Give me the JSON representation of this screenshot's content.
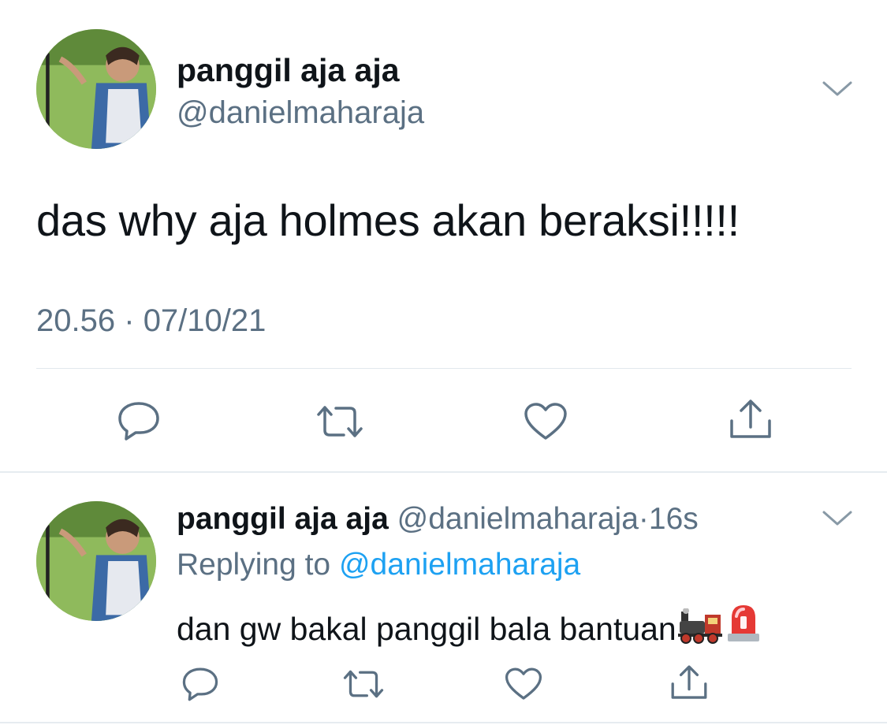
{
  "main_tweet": {
    "display_name": "panggil aja aja",
    "handle": "@danielmaharaja",
    "text": "das why aja holmes akan beraksi!!!!!",
    "time": "20.56",
    "separator": "·",
    "date": "07/10/21",
    "menu_icon": "chevron-down-icon",
    "actions": [
      "reply-icon",
      "retweet-icon",
      "like-icon",
      "share-icon"
    ]
  },
  "reply_tweet": {
    "display_name": "panggil aja aja",
    "handle": "@danielmaharaja",
    "separator": "·",
    "age": "16s",
    "replying_label": "Replying to",
    "replying_to": "@danielmaharaja",
    "text": "dan gw bakal panggil bala bantuan",
    "emojis": [
      "locomotive-emoji",
      "police-light-emoji"
    ],
    "menu_icon": "chevron-down-icon",
    "actions": [
      "reply-icon",
      "retweet-icon",
      "like-icon",
      "share-icon"
    ]
  },
  "colors": {
    "text": "#0f1419",
    "secondary": "#5b7083",
    "link": "#1da1f2",
    "divider": "#e1e8ed"
  }
}
